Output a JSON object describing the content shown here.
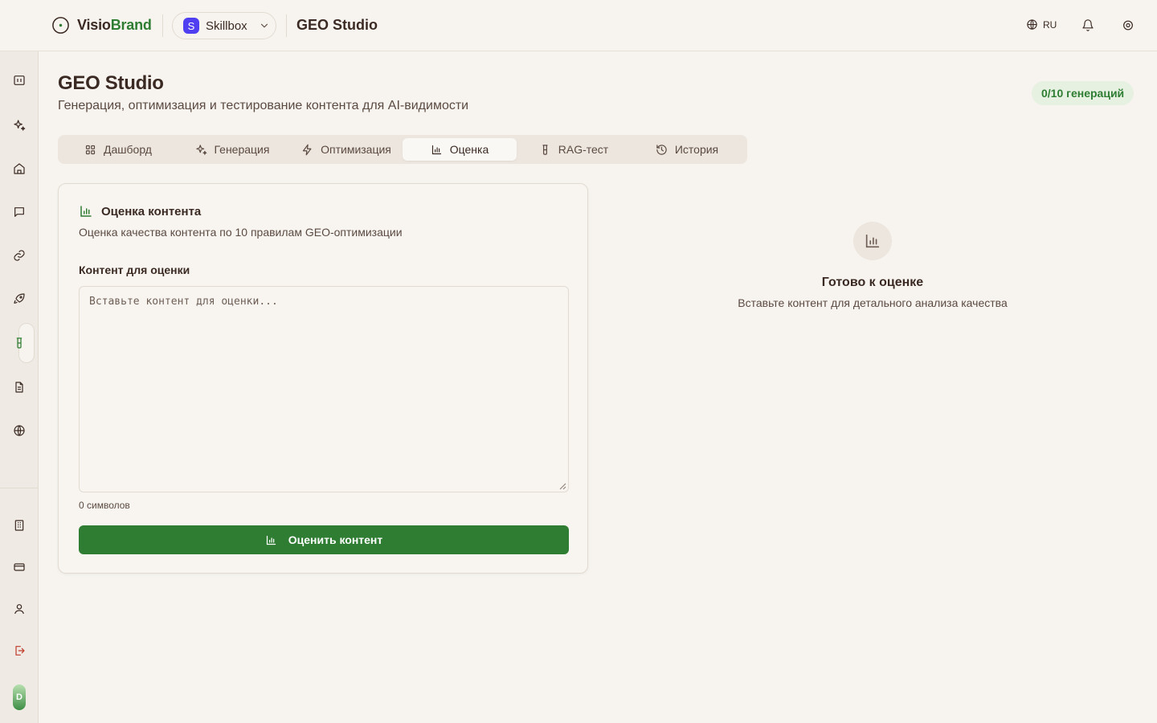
{
  "header": {
    "brand_main": "Visio",
    "brand_accent": "Brand",
    "org_initial": "S",
    "org_name": "Skillbox",
    "section_title": "GEO Studio",
    "language": "RU"
  },
  "sidebar": {
    "items": [
      {
        "icon": "panel-toggle-icon"
      },
      {
        "icon": "sparkles-icon"
      },
      {
        "icon": "home-icon"
      },
      {
        "icon": "chat-icon"
      },
      {
        "icon": "link-icon"
      },
      {
        "icon": "rocket-icon"
      },
      {
        "icon": "flask-icon",
        "active": true
      },
      {
        "icon": "document-icon"
      },
      {
        "icon": "globe-icon"
      }
    ],
    "bottom_items": [
      {
        "icon": "building-icon"
      },
      {
        "icon": "credit-card-icon"
      },
      {
        "icon": "user-icon"
      },
      {
        "icon": "logout-icon"
      }
    ],
    "avatar_initial": "D"
  },
  "page": {
    "title": "GEO Studio",
    "subtitle": "Генерация, оптимизация и тестирование контента для AI-видимости",
    "generations_badge": "0/10 генераций"
  },
  "tabs": [
    {
      "label": "Дашборд",
      "icon": "dashboard-icon"
    },
    {
      "label": "Генерация",
      "icon": "sparkles-icon"
    },
    {
      "label": "Оптимизация",
      "icon": "lightning-icon"
    },
    {
      "label": "Оценка",
      "icon": "bar-chart-icon",
      "active": true
    },
    {
      "label": "RAG-тест",
      "icon": "flask-icon"
    },
    {
      "label": "История",
      "icon": "history-icon"
    }
  ],
  "evaluation_card": {
    "title": "Оценка контента",
    "subtitle": "Оценка качества контента по 10 правилам GEO-оптимизации",
    "field_label": "Контент для оценки",
    "placeholder": "Вставьте контент для оценки...",
    "value": "",
    "char_count": "0 символов",
    "submit_label": "Оценить контент"
  },
  "empty_state": {
    "title": "Готово к оценке",
    "subtitle": "Вставьте контент для детального анализа качества"
  },
  "colors": {
    "accent": "#2e7d32",
    "background": "#f7f4ef",
    "text": "#3b2a23",
    "org_badge": "#4f3ff0",
    "logout": "#c0392b"
  }
}
